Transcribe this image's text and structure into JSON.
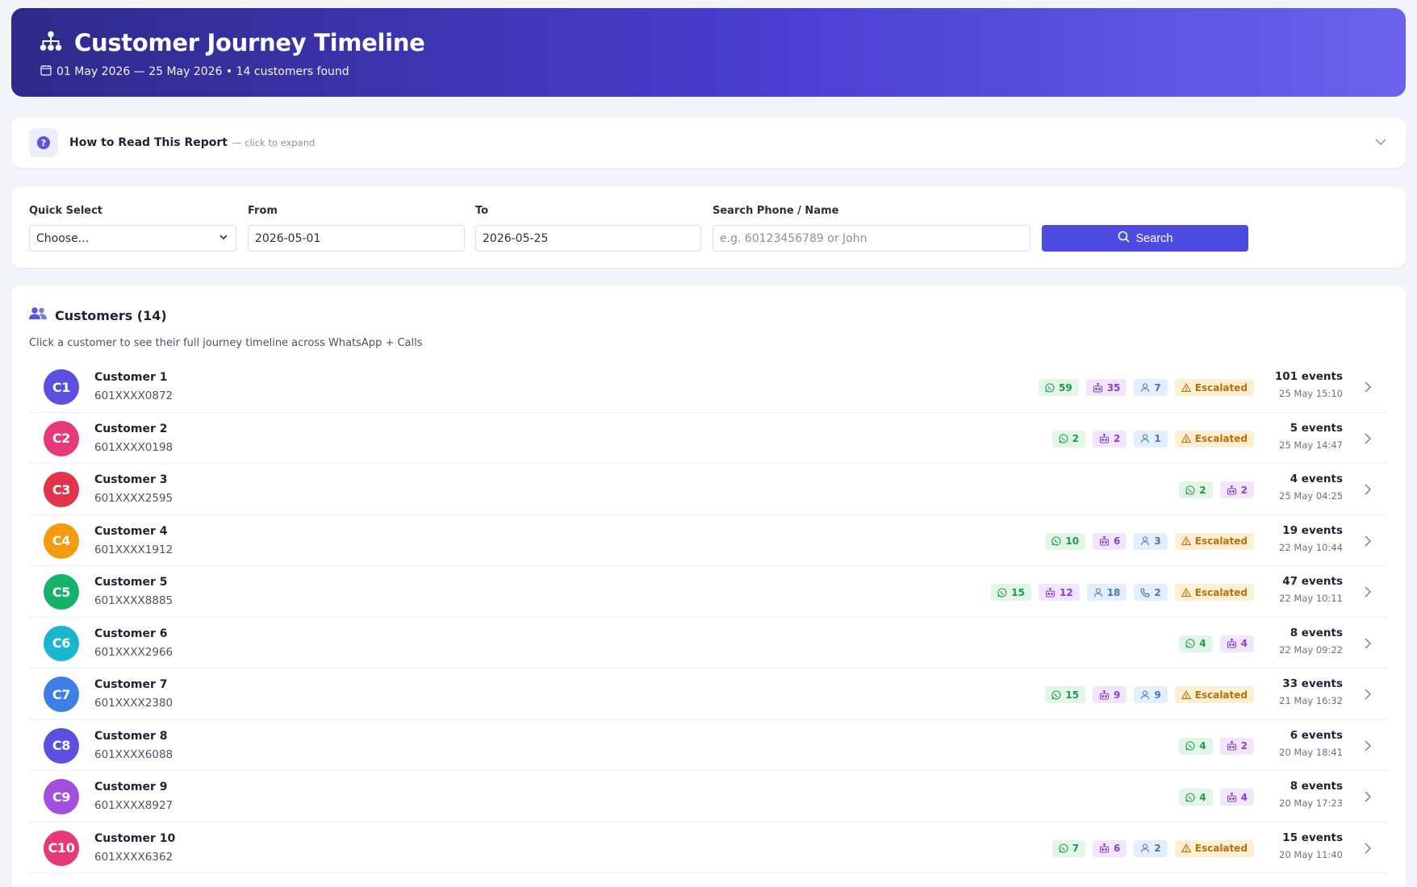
{
  "header": {
    "title": "Customer Journey Timeline",
    "subtitle": "01 May 2026 — 25 May 2026 • 14 customers found"
  },
  "howto": {
    "label": "How to Read This Report",
    "hint": "— click to expand"
  },
  "filters": {
    "quick_select_label": "Quick Select",
    "quick_select_value": "Choose...",
    "from_label": "From",
    "from_value": "2026-05-01",
    "to_label": "To",
    "to_value": "2026-05-25",
    "search_label": "Search Phone / Name",
    "search_placeholder": "e.g. 60123456789 or John",
    "search_button": "Search"
  },
  "customers": {
    "title": "Customers (14)",
    "description": "Click a customer to see their full journey timeline across WhatsApp + Calls",
    "escalated_label": "Escalated",
    "rows": [
      {
        "initials": "C1",
        "color": "#5b4fe0",
        "name": "Customer 1",
        "phone": "601XXXX0872",
        "wa": "59",
        "bot": "35",
        "agent": "7",
        "call": "",
        "escalated": true,
        "events": "101 events",
        "date": "25 May 15:10"
      },
      {
        "initials": "C2",
        "color": "#e5397a",
        "name": "Customer 2",
        "phone": "601XXXX0198",
        "wa": "2",
        "bot": "2",
        "agent": "1",
        "call": "",
        "escalated": true,
        "events": "5 events",
        "date": "25 May 14:47"
      },
      {
        "initials": "C3",
        "color": "#e0344a",
        "name": "Customer 3",
        "phone": "601XXXX2595",
        "wa": "2",
        "bot": "2",
        "agent": "",
        "call": "",
        "escalated": false,
        "events": "4 events",
        "date": "25 May 04:25"
      },
      {
        "initials": "C4",
        "color": "#f59a0c",
        "name": "Customer 4",
        "phone": "601XXXX1912",
        "wa": "10",
        "bot": "6",
        "agent": "3",
        "call": "",
        "escalated": true,
        "events": "19 events",
        "date": "22 May 10:44"
      },
      {
        "initials": "C5",
        "color": "#16b26a",
        "name": "Customer 5",
        "phone": "601XXXX8885",
        "wa": "15",
        "bot": "12",
        "agent": "18",
        "call": "2",
        "escalated": true,
        "events": "47 events",
        "date": "22 May 10:11"
      },
      {
        "initials": "C6",
        "color": "#1ab6d0",
        "name": "Customer 6",
        "phone": "601XXXX2966",
        "wa": "4",
        "bot": "4",
        "agent": "",
        "call": "",
        "escalated": false,
        "events": "8 events",
        "date": "22 May 09:22"
      },
      {
        "initials": "C7",
        "color": "#3d7fe6",
        "name": "Customer 7",
        "phone": "601XXXX2380",
        "wa": "15",
        "bot": "9",
        "agent": "9",
        "call": "",
        "escalated": true,
        "events": "33 events",
        "date": "21 May 16:32"
      },
      {
        "initials": "C8",
        "color": "#5b4fe0",
        "name": "Customer 8",
        "phone": "601XXXX6088",
        "wa": "4",
        "bot": "2",
        "agent": "",
        "call": "",
        "escalated": false,
        "events": "6 events",
        "date": "20 May 18:41"
      },
      {
        "initials": "C9",
        "color": "#a24fe0",
        "name": "Customer 9",
        "phone": "601XXXX8927",
        "wa": "4",
        "bot": "4",
        "agent": "",
        "call": "",
        "escalated": false,
        "events": "8 events",
        "date": "20 May 17:23"
      },
      {
        "initials": "C10",
        "color": "#e5397a",
        "name": "Customer 10",
        "phone": "601XXXX6362",
        "wa": "7",
        "bot": "6",
        "agent": "2",
        "call": "",
        "escalated": true,
        "events": "15 events",
        "date": "20 May 11:40"
      }
    ]
  }
}
